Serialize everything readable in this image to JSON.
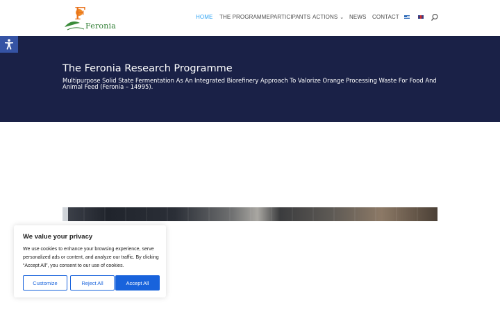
{
  "logo": {
    "text": "Feronia",
    "letter": "F"
  },
  "nav": {
    "items": [
      {
        "label": "HOME",
        "active": true
      },
      {
        "label": "THE PROGRAMME"
      },
      {
        "label": "PARTICIPANTS"
      },
      {
        "label": "ACTIONS",
        "dropdown": true
      },
      {
        "label": "NEWS"
      },
      {
        "label": "CONTACT"
      }
    ],
    "languages": [
      "greek-flag-icon",
      "uk-flag-icon"
    ],
    "search_icon": "search-icon",
    "active_color": "#2ea3f2"
  },
  "accessibility": {
    "icon": "accessibility-icon",
    "color": "#3553a4"
  },
  "hero": {
    "title": "The Feronia Research Programme",
    "subtitle": "Multipurpose Solid State Fermentation As An Integrated Biorefinery Approach To Valorize Orange Processing Waste For Food And Animal Feed (Feronia – 14995).",
    "background": "#1a2147"
  },
  "cookie": {
    "title": "We value your privacy",
    "text": "We use cookies to enhance your browsing experience, serve personalized ads or content, and analyze our traffic. By clicking “Accept All”, you consent to our use of cookies.",
    "customize_label": "Customize",
    "reject_label": "Reject All",
    "accept_label": "Accept All",
    "accent": "#1863dc"
  }
}
